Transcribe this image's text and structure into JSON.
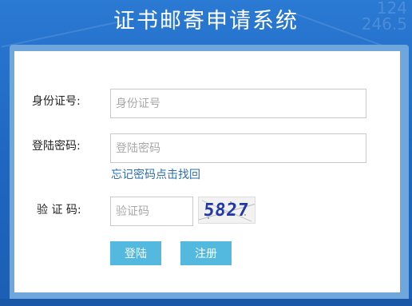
{
  "header": {
    "title": "证书邮寄申请系统",
    "deco_text": "124\n246.5"
  },
  "form": {
    "id_label": "身份证号:",
    "id_placeholder": "身份证号",
    "password_label": "登陆密码:",
    "password_placeholder": "登陆密码",
    "forgot_link": "忘记密码点击找回",
    "captcha_label": "验 证 码:",
    "captcha_placeholder": "验证码",
    "captcha_value": "5827",
    "login_button": "登陆",
    "register_button": "注册"
  },
  "colors": {
    "background": "#1e66bf",
    "button": "#53b9de",
    "link": "#2a6fb2"
  }
}
